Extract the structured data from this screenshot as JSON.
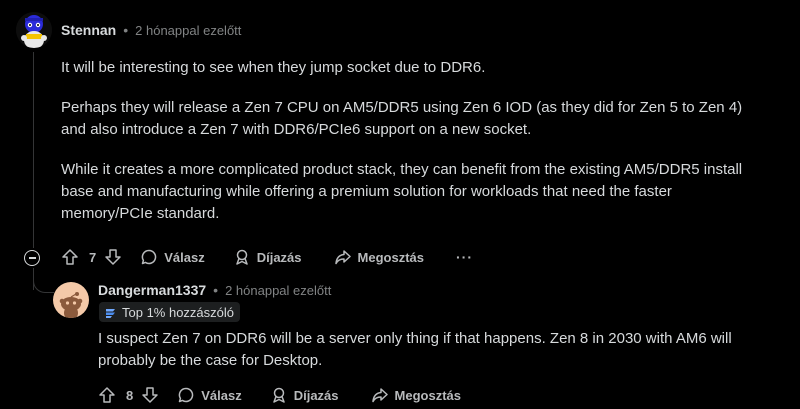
{
  "comment1": {
    "username": "Stennan",
    "separator": "•",
    "time": "2 hónappal ezelőtt",
    "paragraphs": [
      "It will be interesting to see when they jump socket due to DDR6.",
      "Perhaps they will release a Zen 7 CPU on AM5/DDR5 using Zen 6 IOD (as they did for Zen 5 to Zen 4) and also introduce a Zen 7 with DDR6/PCIe6 support on a new socket.",
      "While it creates a more complicated product stack, they can benefit from the existing AM5/DDR5 install base and manufacturing while offering a premium solution for workloads that need the faster memory/PCIe standard."
    ],
    "actions": {
      "votes": "7",
      "reply": "Válasz",
      "award": "Díjazás",
      "share": "Megosztás",
      "more": "···"
    }
  },
  "comment2": {
    "username": "Dangerman1337",
    "separator": "•",
    "time": "2 hónappal ezelőtt",
    "badge": "Top 1% hozzászóló",
    "paragraphs": [
      "I suspect Zen 7 on DDR6 will be a server only thing if that happens. Zen 8 in 2030 with AM6 will probably be the case for Desktop."
    ],
    "actions": {
      "votes": "8",
      "reply": "Válasz",
      "award": "Díjazás",
      "share": "Megosztás"
    }
  },
  "colors": {
    "background": "#000000",
    "text": "#d7dadc",
    "muted": "#818384",
    "thread_line": "#343536",
    "avatar2": "#f4c9a8"
  }
}
